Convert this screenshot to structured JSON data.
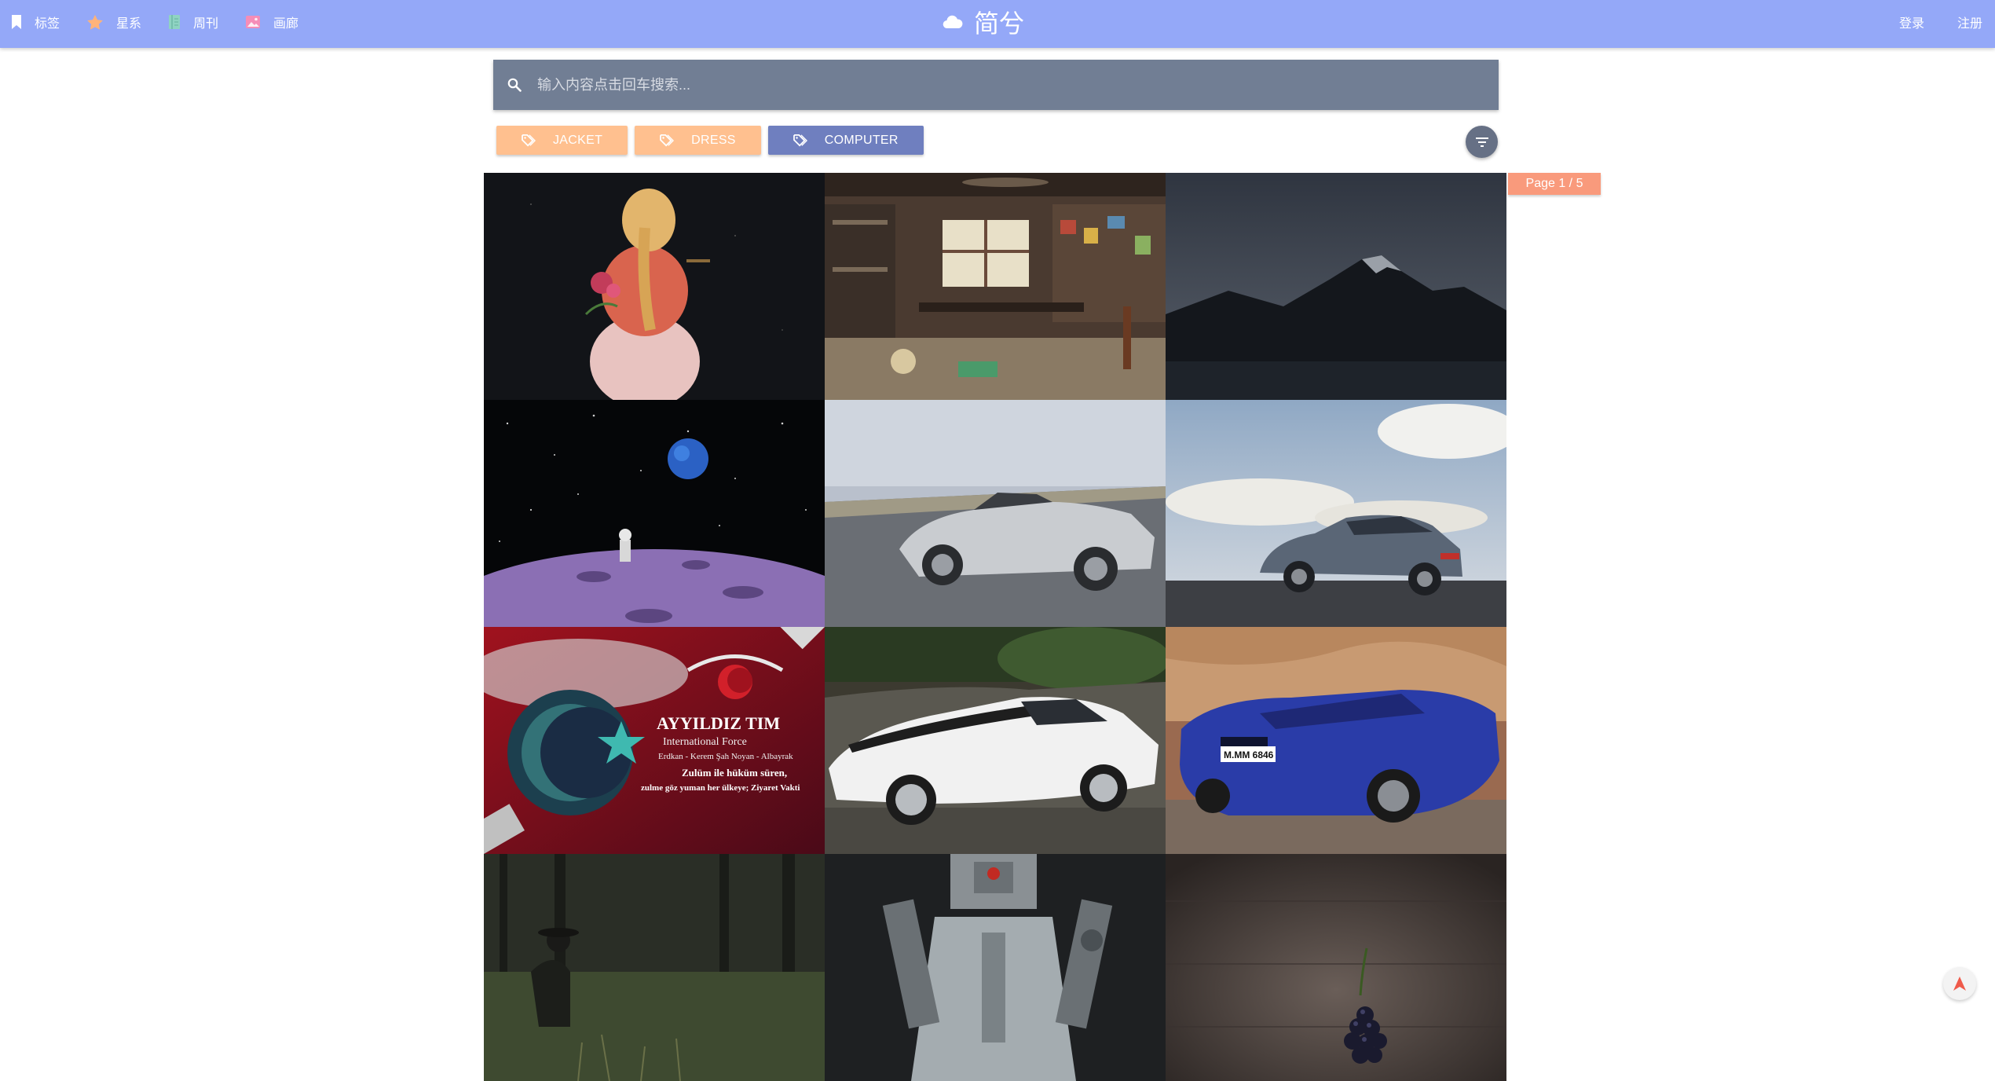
{
  "nav": {
    "items": [
      {
        "label": "标签",
        "icon": "bookmark-icon",
        "color": "#ffffff"
      },
      {
        "label": "星系",
        "icon": "star-icon",
        "color": "#ffb37a"
      },
      {
        "label": "周刊",
        "icon": "magazine-icon",
        "color": "#8fd3c2"
      },
      {
        "label": "画廊",
        "icon": "image-icon",
        "color": "#f58db7"
      }
    ],
    "brand": "简兮",
    "login": "登录",
    "register": "注册"
  },
  "search": {
    "placeholder": "输入内容点击回车搜索..."
  },
  "tags": [
    {
      "label": "JACKET",
      "color": "#ffc08f"
    },
    {
      "label": "DRESS",
      "color": "#ffc08f"
    },
    {
      "label": "COMPUTER",
      "color": "#6f7fbf"
    }
  ],
  "pager": {
    "label": "Page 1 / 5"
  },
  "gallery": {
    "banner_lines": [
      "AYYILDIZ TIM",
      "International Force",
      "Erdkan - Kerem Şah Noyan - Albayrak",
      "Zulüm ile hüküm süren,",
      "zulme göz yuman her ülkeye; Ziyaret Vakti"
    ],
    "plate_text": "M.MM 6846"
  },
  "colors": {
    "topbar": "#94a8f8",
    "search": "#717e94",
    "tag_orange": "#ffc08f",
    "tag_blue": "#6f7fbf",
    "page_badge": "#f99a7c",
    "filter_button": "#667085"
  }
}
